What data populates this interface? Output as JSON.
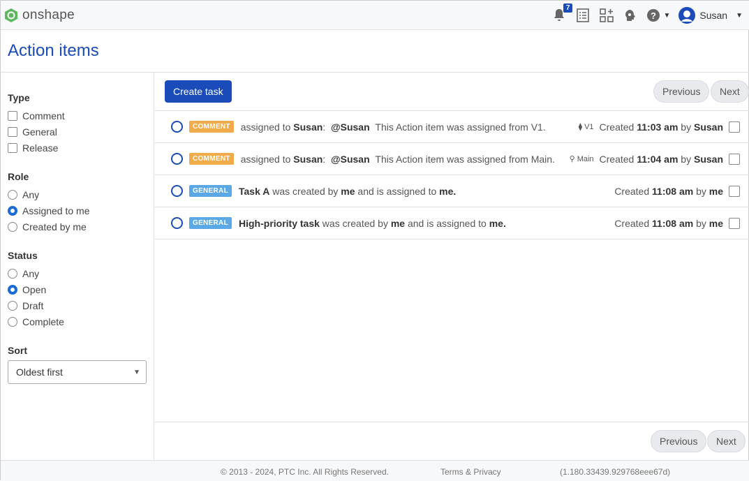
{
  "app": {
    "logo_text": "onshape",
    "notification_count": "7",
    "user_name": "Susan"
  },
  "page_title": "Action items",
  "sidebar": {
    "type": {
      "label": "Type",
      "options": [
        "Comment",
        "General",
        "Release"
      ]
    },
    "role": {
      "label": "Role",
      "options": [
        "Any",
        "Assigned to me",
        "Created by me"
      ],
      "selected": "Assigned to me"
    },
    "status": {
      "label": "Status",
      "options": [
        "Any",
        "Open",
        "Draft",
        "Complete"
      ],
      "selected": "Open"
    },
    "sort": {
      "label": "Sort",
      "value": "Oldest first"
    }
  },
  "toolbar": {
    "create_task": "Create task",
    "previous": "Previous",
    "next": "Next"
  },
  "items": [
    {
      "tag": "COMMENT",
      "p1": "assigned to ",
      "b1": "Susan",
      ":": "",
      "p2": ":",
      "b2": "@Susan",
      "p3": "This Action item was assigned from V1.",
      "branch": "V1",
      "created": "Created",
      "time": "11:03 am",
      "by": "by",
      "author": "Susan"
    },
    {
      "tag": "COMMENT",
      "p1": "assigned to ",
      "b1": "Susan",
      "p2": ":",
      "b2": "@Susan",
      "p3": "This Action item was assigned from Main.",
      "branch": "Main",
      "created": "Created",
      "time": "11:04 am",
      "by": "by",
      "author": "Susan"
    },
    {
      "tag": "GENERAL",
      "b1": "Task A",
      "p1": " was created by ",
      "b2": "me",
      "p2": " and is assigned to ",
      "b3": "me.",
      "created": "Created",
      "time": "11:08 am",
      "by": "by",
      "author": "me"
    },
    {
      "tag": "GENERAL",
      "b1": "High-priority task",
      "p1": " was created by ",
      "b2": "me",
      "p2": " and is assigned to ",
      "b3": "me.",
      "created": "Created",
      "time": "11:08 am",
      "by": "by",
      "author": "me"
    }
  ],
  "footer": {
    "copyright": "© 2013 - 2024, PTC Inc. All Rights Reserved.",
    "terms": "Terms & Privacy",
    "version": "(1.180.33439.929768eee67d)"
  },
  "colors": {
    "accent": "#1a4bb8",
    "comment_tag": "#f0ac4a",
    "general_tag": "#5aa9e6",
    "logo": "#5cb85c"
  }
}
